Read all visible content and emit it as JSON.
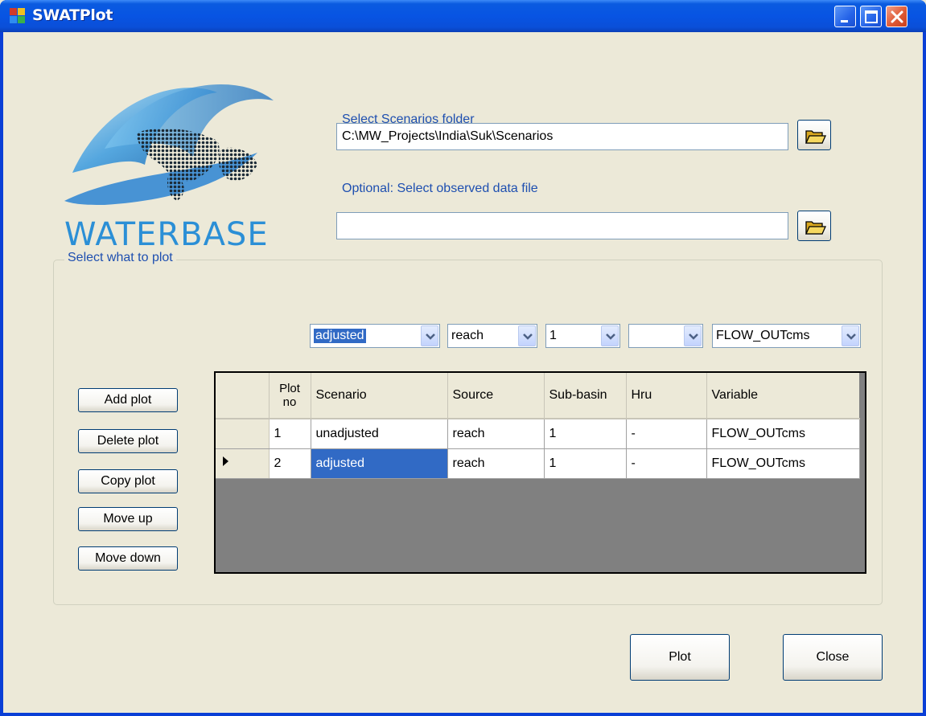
{
  "window": {
    "title": "SWATPlot",
    "colors": {
      "title_bar": "#0854e3",
      "client_bg": "#ece9d8",
      "label_blue": "#1e4fb0",
      "selection": "#316ac5"
    }
  },
  "logo": {
    "brand": "WATERBASE"
  },
  "scenarios": {
    "label": "Select Scenarios folder",
    "path": "C:\\MW_Projects\\India\\Suk\\Scenarios",
    "browse_icon": "folder-open-icon"
  },
  "observed": {
    "label": "Optional: Select observed data file",
    "path": "",
    "browse_icon": "folder-open-icon"
  },
  "plot_group": {
    "title": "Select what to plot",
    "selectors": {
      "scenario": "adjusted",
      "source": "reach",
      "subbasin": "1",
      "hru": "",
      "variable": "FLOW_OUTcms"
    },
    "buttons": {
      "add": "Add plot",
      "delete": "Delete plot",
      "copy": "Copy plot",
      "up": "Move up",
      "down": "Move down"
    },
    "table": {
      "headers": [
        "Plot no",
        "Scenario",
        "Source",
        "Sub-basin",
        "Hru",
        "Variable"
      ],
      "rows": [
        {
          "plot_no": "1",
          "scenario": "unadjusted",
          "source": "reach",
          "subbasin": "1",
          "hru": "-",
          "variable": "FLOW_OUTcms",
          "current": false
        },
        {
          "plot_no": "2",
          "scenario": "adjusted",
          "source": "reach",
          "subbasin": "1",
          "hru": "-",
          "variable": "FLOW_OUTcms",
          "current": true
        }
      ]
    }
  },
  "footer": {
    "plot": "Plot",
    "close": "Close"
  }
}
